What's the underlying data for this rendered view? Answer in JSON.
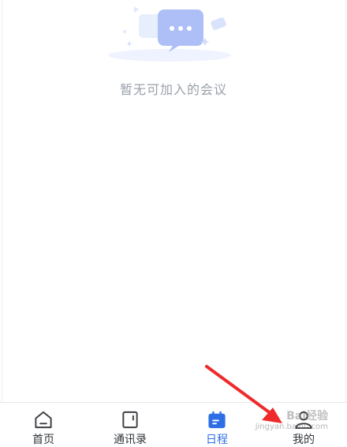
{
  "empty_state": {
    "message": "暂无可加入的会议"
  },
  "tabbar": {
    "items": [
      {
        "label": "首页",
        "icon": "home-icon",
        "active": false
      },
      {
        "label": "通讯录",
        "icon": "contacts-icon",
        "active": false
      },
      {
        "label": "日程",
        "icon": "calendar-icon",
        "active": true
      },
      {
        "label": "我的",
        "icon": "user-icon",
        "active": false
      }
    ]
  },
  "watermark": {
    "main": "Bai经验",
    "sub": "jingyan.baidu.com"
  },
  "colors": {
    "accent": "#2f6fe6",
    "annotation_arrow": "#ee2a2a",
    "empty_text": "#9aa0a8"
  }
}
